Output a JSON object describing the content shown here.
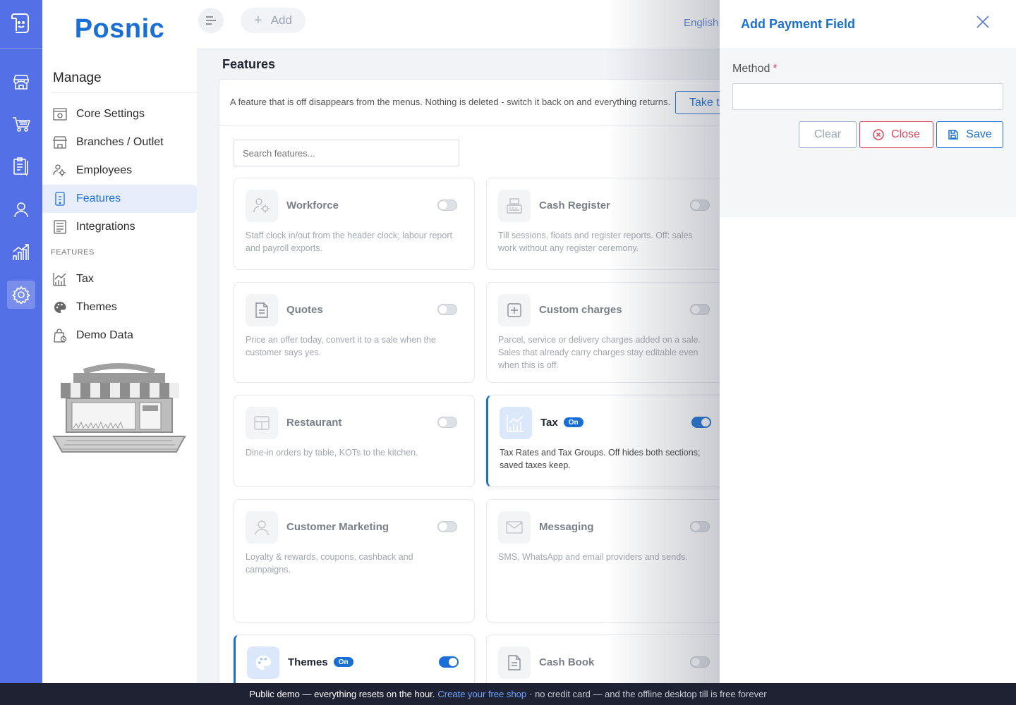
{
  "brand": {
    "name": "Posnic"
  },
  "topbar": {
    "add_label": "Add",
    "language": "English"
  },
  "sidebar": {
    "section_title": "Manage",
    "items": [
      {
        "label": "Core Settings",
        "icon": "settings-panel-icon"
      },
      {
        "label": "Branches / Outlet",
        "icon": "store-icon"
      },
      {
        "label": "Employees",
        "icon": "users-gear-icon"
      },
      {
        "label": "Features",
        "icon": "tablet-icon",
        "active": true
      },
      {
        "label": "Integrations",
        "icon": "list-doc-icon"
      }
    ],
    "features_heading": "FEATURES",
    "feature_items": [
      {
        "label": "Tax",
        "icon": "chart-icon"
      },
      {
        "label": "Themes",
        "icon": "palette-icon"
      },
      {
        "label": "Demo Data",
        "icon": "bag-icon"
      }
    ]
  },
  "page": {
    "title": "Features",
    "banner_text": "A feature that is off disappears from the menus. Nothing is deleted - switch it back on and everything returns.",
    "banner_button": "Take th",
    "search_placeholder": "Search features..."
  },
  "features": [
    {
      "name": "Workforce",
      "desc": "Staff clock in/out from the header clock; labour report and payroll exports.",
      "on": false
    },
    {
      "name": "Cash Register",
      "desc": "Till sessions, floats and register reports. Off: sales work without any register ceremony.",
      "on": false
    },
    {
      "name": "Quotes",
      "desc": "Price an offer today, convert it to a sale when the customer says yes.",
      "on": false
    },
    {
      "name": "Custom charges",
      "desc": "Parcel, service or delivery charges added on a sale. Sales that already carry charges stay editable even when this is off.",
      "on": false
    },
    {
      "name": "Restaurant",
      "desc": "Dine-in orders by table, KOTs to the kitchen.",
      "on": false
    },
    {
      "name": "Tax",
      "desc": "Tax Rates and Tax Groups. Off hides both sections; saved taxes keep.",
      "on": true,
      "badge": "On"
    },
    {
      "name": "Customer Marketing",
      "desc": "Loyalty & rewards, coupons, cashback and campaigns.",
      "on": false
    },
    {
      "name": "Messaging",
      "desc": "SMS, WhatsApp and email providers and sends.",
      "on": false
    },
    {
      "name": "Themes",
      "desc": "",
      "on": true,
      "badge": "On"
    },
    {
      "name": "Cash Book",
      "desc": "",
      "on": false
    }
  ],
  "drawer": {
    "title": "Add Payment Field",
    "method_label": "Method",
    "required_mark": "*",
    "method_value": "",
    "clear_label": "Clear",
    "close_label": "Close",
    "save_label": "Save"
  },
  "footer": {
    "text1": "Public demo — everything resets on the hour.",
    "link": "Create your free shop",
    "text2": "· no credit card — and the offline desktop till is free forever"
  },
  "colors": {
    "rail": "#5470e6",
    "accent": "#1a6fd6",
    "danger": "#e0455e",
    "footer": "#1e2233"
  }
}
